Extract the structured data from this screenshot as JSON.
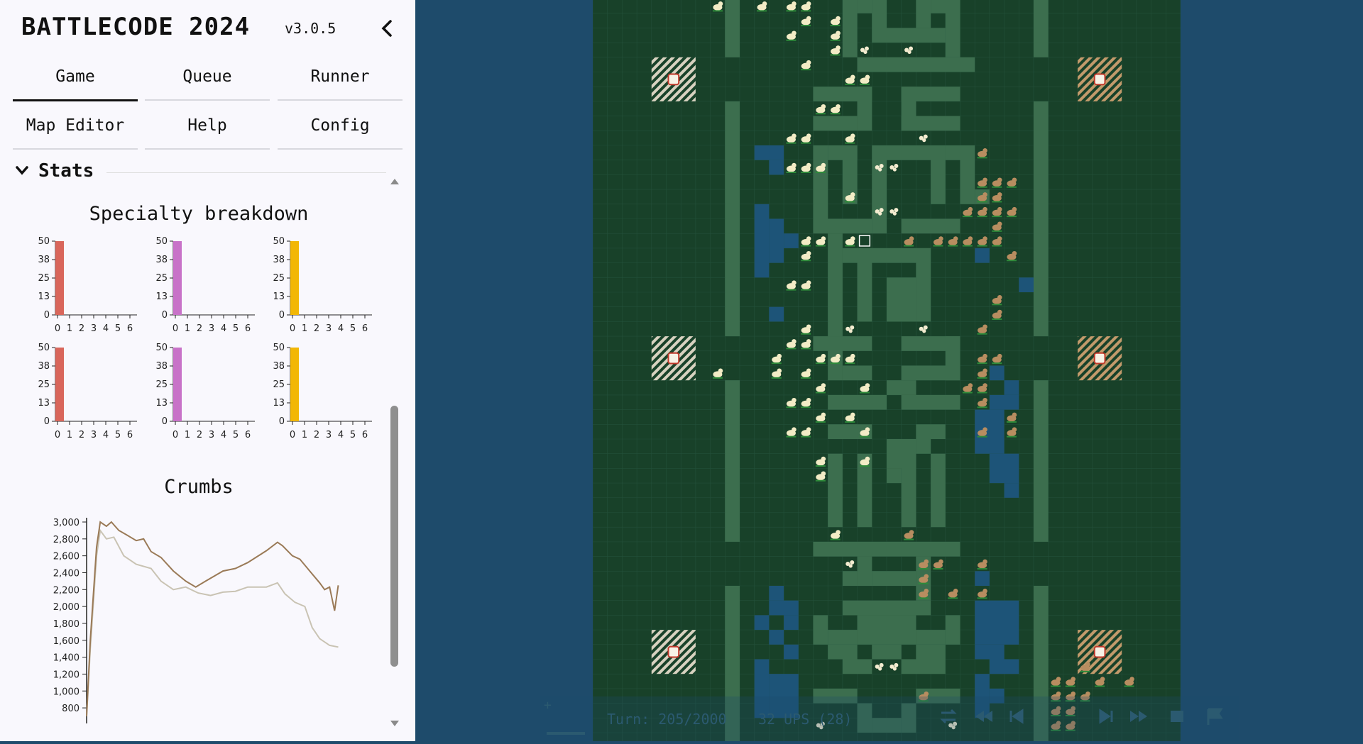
{
  "app": {
    "title": "BATTLECODE 2024",
    "version": "v3.0.5"
  },
  "tabs": [
    {
      "label": "Game",
      "active": true
    },
    {
      "label": "Queue",
      "active": false
    },
    {
      "label": "Runner",
      "active": false
    },
    {
      "label": "Map Editor",
      "active": false
    },
    {
      "label": "Help",
      "active": false
    },
    {
      "label": "Config",
      "active": false
    }
  ],
  "stats": {
    "section_title": "Stats",
    "specialty": {
      "title": "Specialty breakdown",
      "charts": [
        {
          "color": "#d9665b",
          "y_ticks": [
            "50",
            "38",
            "25",
            "13",
            "0"
          ],
          "x_ticks": [
            "0",
            "1",
            "2",
            "3",
            "4",
            "5",
            "6"
          ],
          "values": [
            50,
            0,
            0,
            0,
            0,
            0,
            0
          ]
        },
        {
          "color": "#c872c8",
          "y_ticks": [
            "50",
            "38",
            "25",
            "13",
            "0"
          ],
          "x_ticks": [
            "0",
            "1",
            "2",
            "3",
            "4",
            "5",
            "6"
          ],
          "values": [
            50,
            0,
            0,
            0,
            0,
            0,
            0
          ]
        },
        {
          "color": "#f2b705",
          "y_ticks": [
            "50",
            "38",
            "25",
            "13",
            "0"
          ],
          "x_ticks": [
            "0",
            "1",
            "2",
            "3",
            "4",
            "5",
            "6"
          ],
          "values": [
            50,
            0,
            0,
            0,
            0,
            0,
            0
          ]
        },
        {
          "color": "#d9665b",
          "y_ticks": [
            "50",
            "38",
            "25",
            "13",
            "0"
          ],
          "x_ticks": [
            "0",
            "1",
            "2",
            "3",
            "4",
            "5",
            "6"
          ],
          "values": [
            50,
            0,
            0,
            0,
            0,
            0,
            0
          ]
        },
        {
          "color": "#c872c8",
          "y_ticks": [
            "50",
            "38",
            "25",
            "13",
            "0"
          ],
          "x_ticks": [
            "0",
            "1",
            "2",
            "3",
            "4",
            "5",
            "6"
          ],
          "values": [
            50,
            0,
            0,
            0,
            0,
            0,
            0
          ]
        },
        {
          "color": "#f2b705",
          "y_ticks": [
            "50",
            "38",
            "25",
            "13",
            "0"
          ],
          "x_ticks": [
            "0",
            "1",
            "2",
            "3",
            "4",
            "5",
            "6"
          ],
          "values": [
            50,
            0,
            0,
            0,
            0,
            0,
            0
          ]
        }
      ]
    },
    "crumbs": {
      "title": "Crumbs",
      "y_ticks": [
        "3,000",
        "2,800",
        "2,600",
        "2,400",
        "2,200",
        "2,000",
        "1,800",
        "1,600",
        "1,400",
        "1,200",
        "1,000",
        "800"
      ]
    }
  },
  "chart_data": [
    {
      "type": "bar",
      "categories": [
        "0",
        "1",
        "2",
        "3",
        "4",
        "5",
        "6"
      ],
      "values": [
        50,
        0,
        0,
        0,
        0,
        0,
        0
      ],
      "ylim": [
        0,
        50
      ]
    },
    {
      "type": "bar",
      "categories": [
        "0",
        "1",
        "2",
        "3",
        "4",
        "5",
        "6"
      ],
      "values": [
        50,
        0,
        0,
        0,
        0,
        0,
        0
      ],
      "ylim": [
        0,
        50
      ]
    },
    {
      "type": "bar",
      "categories": [
        "0",
        "1",
        "2",
        "3",
        "4",
        "5",
        "6"
      ],
      "values": [
        50,
        0,
        0,
        0,
        0,
        0,
        0
      ],
      "ylim": [
        0,
        50
      ]
    },
    {
      "type": "bar",
      "categories": [
        "0",
        "1",
        "2",
        "3",
        "4",
        "5",
        "6"
      ],
      "values": [
        50,
        0,
        0,
        0,
        0,
        0,
        0
      ],
      "ylim": [
        0,
        50
      ]
    },
    {
      "type": "bar",
      "categories": [
        "0",
        "1",
        "2",
        "3",
        "4",
        "5",
        "6"
      ],
      "values": [
        50,
        0,
        0,
        0,
        0,
        0,
        0
      ],
      "ylim": [
        0,
        50
      ]
    },
    {
      "type": "bar",
      "categories": [
        "0",
        "1",
        "2",
        "3",
        "4",
        "5",
        "6"
      ],
      "values": [
        50,
        0,
        0,
        0,
        0,
        0,
        0
      ],
      "ylim": [
        0,
        50
      ]
    },
    {
      "type": "line",
      "title": "Crumbs",
      "ylim": [
        700,
        3000
      ],
      "xlim": [
        0,
        205
      ],
      "series": [
        {
          "color": "#9a7a57",
          "points": [
            [
              0,
              700
            ],
            [
              3,
              1600
            ],
            [
              8,
              2700
            ],
            [
              11,
              3000
            ],
            [
              16,
              2950
            ],
            [
              20,
              3000
            ],
            [
              26,
              2900
            ],
            [
              32,
              2850
            ],
            [
              40,
              2780
            ],
            [
              46,
              2800
            ],
            [
              52,
              2650
            ],
            [
              60,
              2580
            ],
            [
              70,
              2420
            ],
            [
              80,
              2300
            ],
            [
              88,
              2230
            ],
            [
              96,
              2300
            ],
            [
              110,
              2420
            ],
            [
              120,
              2450
            ],
            [
              130,
              2520
            ],
            [
              145,
              2660
            ],
            [
              154,
              2760
            ],
            [
              158,
              2720
            ],
            [
              166,
              2600
            ],
            [
              172,
              2560
            ],
            [
              180,
              2420
            ],
            [
              188,
              2280
            ],
            [
              192,
              2200
            ],
            [
              196,
              2230
            ],
            [
              200,
              1950
            ],
            [
              203,
              2250
            ]
          ]
        },
        {
          "color": "#c9c3b3",
          "points": [
            [
              0,
              700
            ],
            [
              3,
              1500
            ],
            [
              8,
              2600
            ],
            [
              11,
              2900
            ],
            [
              16,
              2800
            ],
            [
              22,
              2820
            ],
            [
              30,
              2600
            ],
            [
              40,
              2500
            ],
            [
              52,
              2450
            ],
            [
              60,
              2300
            ],
            [
              70,
              2200
            ],
            [
              80,
              2230
            ],
            [
              90,
              2160
            ],
            [
              100,
              2130
            ],
            [
              110,
              2170
            ],
            [
              120,
              2180
            ],
            [
              130,
              2230
            ],
            [
              145,
              2230
            ],
            [
              154,
              2280
            ],
            [
              160,
              2150
            ],
            [
              168,
              2050
            ],
            [
              176,
              2000
            ],
            [
              182,
              1750
            ],
            [
              188,
              1620
            ],
            [
              196,
              1540
            ],
            [
              203,
              1520
            ]
          ]
        }
      ]
    }
  ],
  "map_colors": {
    "water": "#1e4b6b",
    "floor": "#184129",
    "wall": "#3c6e4e",
    "pit": "#1d5478",
    "duck_a": "#f3ecc6",
    "duck_b": "#b88d60"
  },
  "controls": {
    "turn": "Turn: 205/2000",
    "ups": "32 UPS (28)"
  }
}
